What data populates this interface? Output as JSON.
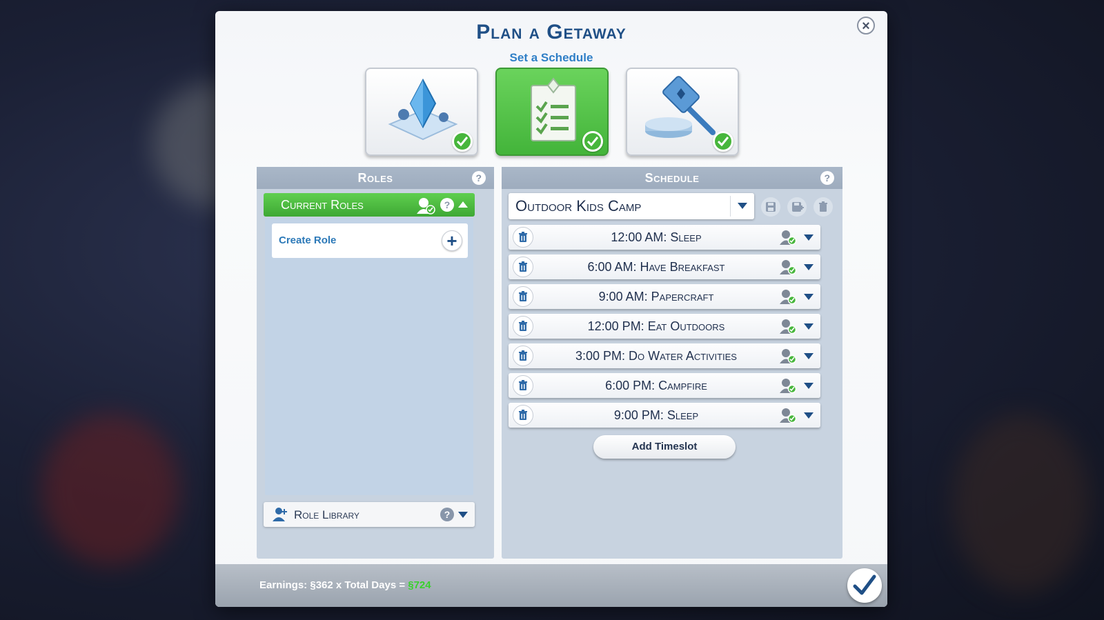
{
  "dialog": {
    "title": "Plan a Getaway",
    "subtitle": "Set a Schedule",
    "close_icon": "close-icon"
  },
  "steps": [
    {
      "name": "lot-step",
      "icon": "lot-plumbob-icon",
      "active": false,
      "completed": true
    },
    {
      "name": "schedule-step",
      "icon": "checklist-icon",
      "active": true,
      "completed": true
    },
    {
      "name": "rules-step",
      "icon": "gavel-icon",
      "active": false,
      "completed": true
    }
  ],
  "roles": {
    "header": "Roles",
    "current_roles": "Current Roles",
    "create_role": "Create Role",
    "role_library": "Role Library"
  },
  "schedule": {
    "header": "Schedule",
    "selected": "Outdoor Kids Camp",
    "timeslots": [
      {
        "label": "12:00 AM: Sleep"
      },
      {
        "label": "6:00 AM: Have Breakfast"
      },
      {
        "label": "9:00 AM: Papercraft"
      },
      {
        "label": "12:00 PM: Eat Outdoors"
      },
      {
        "label": "3:00 PM: Do Water Activities"
      },
      {
        "label": "6:00 PM: Campfire"
      },
      {
        "label": "9:00 PM: Sleep"
      }
    ],
    "add_timeslot": "Add Timeslot"
  },
  "footer": {
    "earnings_prefix": "Earnings: ",
    "currency_symbol": "§",
    "per_day": "362",
    "middle_text": " x Total Days = ",
    "total": "724"
  },
  "colors": {
    "accent_green": "#47b63c",
    "title_blue": "#1f4f86",
    "subtitle_blue": "#2f7fc7",
    "total_green": "#39d12d"
  }
}
